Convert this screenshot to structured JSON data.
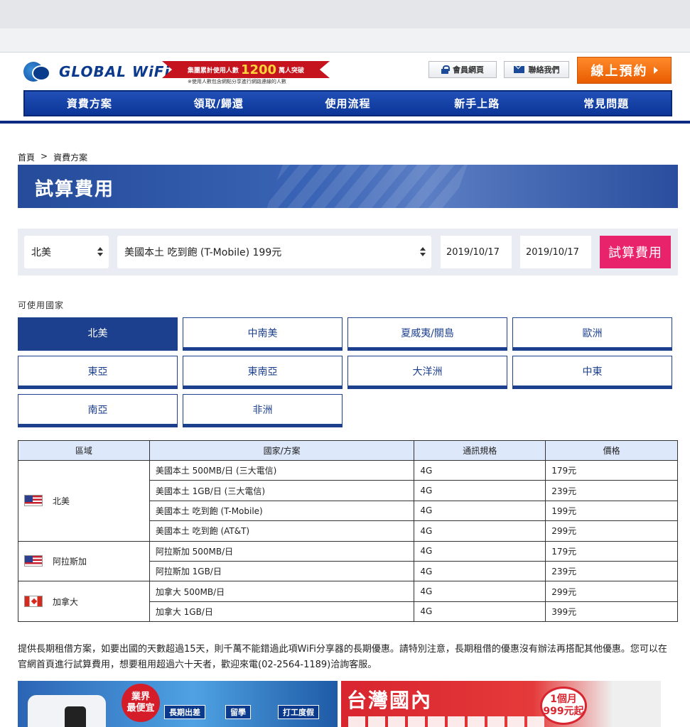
{
  "header": {
    "logo_text": "GLOBAL WiFi",
    "banner_prefix": "集團累計使用人數",
    "banner_number": "1200",
    "banner_suffix": "萬人突破",
    "banner_note": "※使用人數包含網點分享進行網路連線的人數",
    "member_label": "會員網頁",
    "contact_label": "聯絡我們",
    "reserve_label": "線上預約"
  },
  "nav": {
    "items": [
      "資費方案",
      "領取/歸還",
      "使用流程",
      "新手上路",
      "常見問題"
    ]
  },
  "breadcrumb": {
    "home": "首頁",
    "separator": ">",
    "current": "資費方案"
  },
  "hero": {
    "title": "試算費用"
  },
  "calculator": {
    "region_value": "北美",
    "plan_value": "美國本土 吃到飽 (T-Mobile) 199元",
    "start_date": "2019/10/17",
    "end_date": "2019/10/17",
    "submit_label": "試算費用"
  },
  "available": {
    "label": "可使用國家",
    "tabs": [
      "北美",
      "中南美",
      "夏威夷/關島",
      "歐洲",
      "東亞",
      "東南亞",
      "大洋洲",
      "中東",
      "南亞",
      "非洲"
    ],
    "active": "北美"
  },
  "table": {
    "headers": [
      "區域",
      "國家/方案",
      "通訊規格",
      "價格"
    ],
    "groups": [
      {
        "region": "北美",
        "flag": "us-flag",
        "rows": [
          {
            "plan": "美國本土 500MB/日 (三大電信)",
            "spec": "4G",
            "price": "179元"
          },
          {
            "plan": "美國本土 1GB/日 (三大電信)",
            "spec": "4G",
            "price": "239元"
          },
          {
            "plan": "美國本土 吃到飽 (T-Mobile)",
            "spec": "4G",
            "price": "199元"
          },
          {
            "plan": "美國本土 吃到飽 (AT&T)",
            "spec": "4G",
            "price": "299元"
          }
        ]
      },
      {
        "region": "阿拉斯加",
        "flag": "us-flag",
        "rows": [
          {
            "plan": "阿拉斯加 500MB/日",
            "spec": "4G",
            "price": "179元"
          },
          {
            "plan": "阿拉斯加 1GB/日",
            "spec": "4G",
            "price": "239元"
          }
        ]
      },
      {
        "region": "加拿大",
        "flag": "canada-flag",
        "rows": [
          {
            "plan": "加拿大 500MB/日",
            "spec": "4G",
            "price": "299元"
          },
          {
            "plan": "加拿大 1GB/日",
            "spec": "4G",
            "price": "399元"
          }
        ]
      }
    ]
  },
  "note": "提供長期租借方案，如要出國的天數超過15天，則千萬不能錯過此項WiFi分享器的長期優惠。請特別注意，長期租借的優惠沒有辦法再搭配其他優惠。您可以在官網首頁進行試算費用，想要租用超過六十天者，歡迎來電(02-2564-1189)洽詢客服。",
  "promos": {
    "left": {
      "badge_line1": "業界",
      "badge_line2": "最便宜",
      "tags": [
        "長期出差",
        "留學",
        "打工度假"
      ]
    },
    "right": {
      "title": "台灣國內",
      "badge_line1": "1個月",
      "badge_line2": "999元起"
    }
  },
  "colors": {
    "brand_blue": "#1c3f8e",
    "accent_pink": "#e8236c",
    "reserve_orange": "#f07010",
    "table_header": "#dde8fa"
  }
}
